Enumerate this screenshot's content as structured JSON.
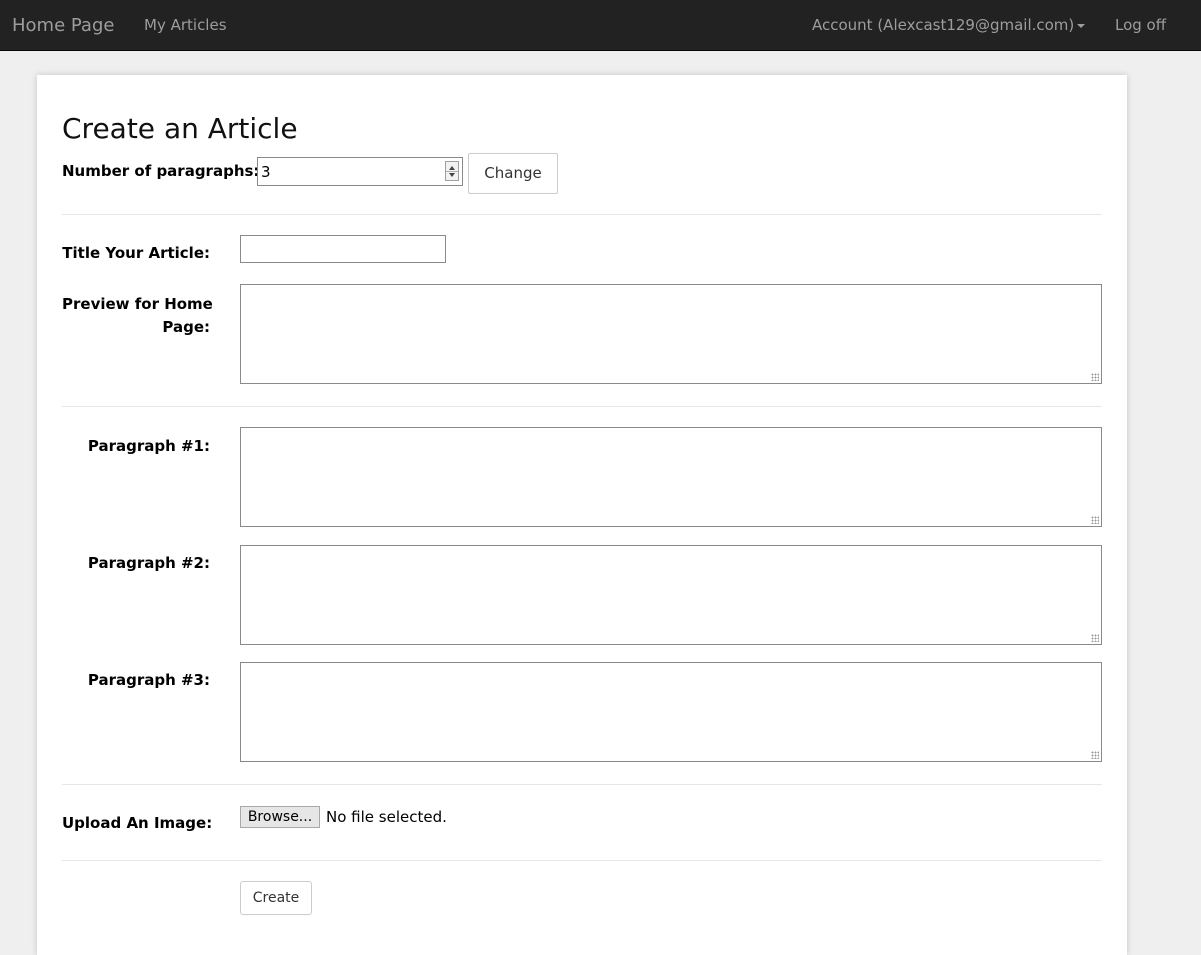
{
  "navbar": {
    "brand": "Home Page",
    "my_articles": "My Articles",
    "account": "Account (Alexcast129@gmail.com)",
    "logoff": "Log off"
  },
  "form": {
    "title": "Create an Article",
    "num_paragraphs_label": "Number of paragraphs:",
    "num_paragraphs_value": "3",
    "change_button": "Change",
    "title_label": "Title Your Article:",
    "title_value": "",
    "preview_label_line1": "Preview for Home",
    "preview_label_line2": "Page:",
    "paragraphs": [
      {
        "label": "Paragraph #1:",
        "value": ""
      },
      {
        "label": "Paragraph #2:",
        "value": ""
      },
      {
        "label": "Paragraph #3:",
        "value": ""
      }
    ],
    "upload_label": "Upload An Image:",
    "browse_button": "Browse...",
    "file_status": "No file selected.",
    "create_button": "Create"
  },
  "colors": {
    "navbar_bg": "#222222",
    "navbar_text": "#9d9d9d",
    "page_bg": "#efefef"
  }
}
